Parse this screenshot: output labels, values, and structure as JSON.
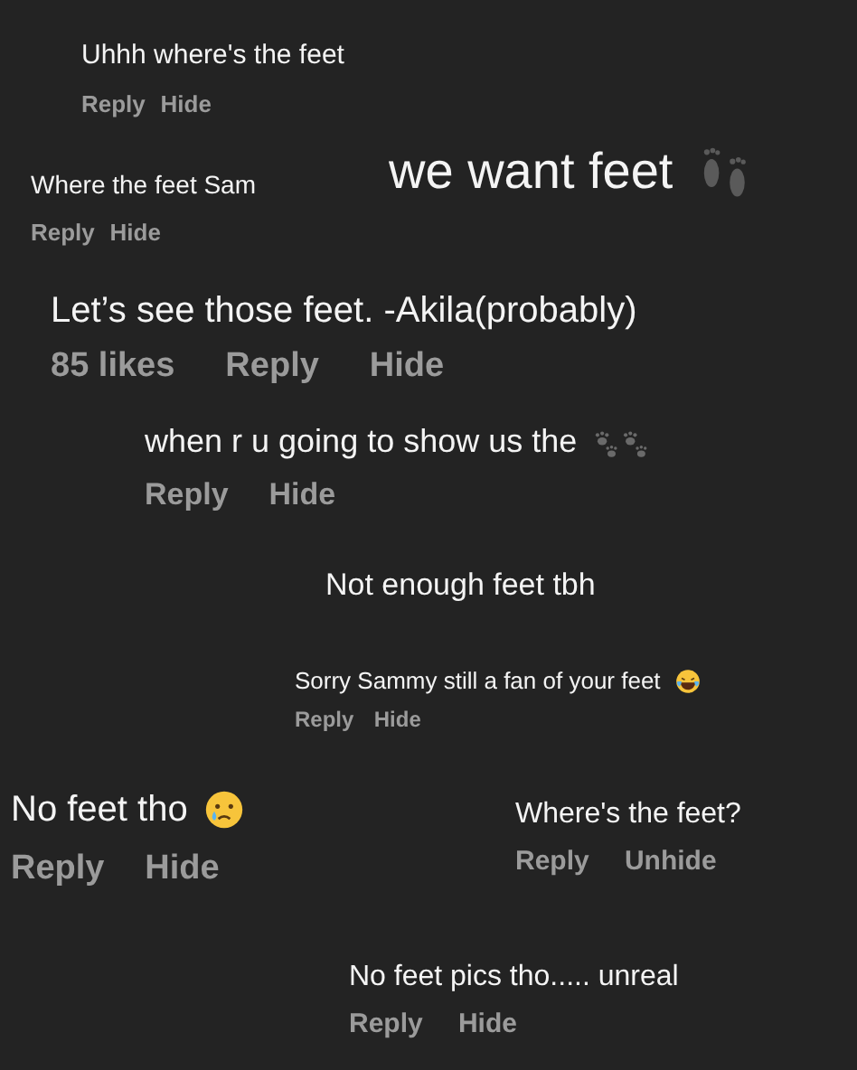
{
  "comments": [
    {
      "kind": "plain",
      "text": "Uhhh where's the feet",
      "actions": [
        "Reply",
        "Hide"
      ]
    },
    {
      "kind": "plain",
      "text": "Where the feet Sam",
      "actions": [
        "Reply",
        "Hide"
      ]
    },
    {
      "kind": "footprints",
      "text": "we want feet"
    },
    {
      "kind": "plain",
      "text": "Let’s see those feet. -Akila(probably)",
      "actions": [
        "85 likes",
        "Reply",
        "Hide"
      ]
    },
    {
      "kind": "paws",
      "text": "when r u going to show us the",
      "actions": [
        "Reply",
        "Hide"
      ]
    },
    {
      "kind": "plain",
      "text": "Not enough feet tbh"
    },
    {
      "kind": "laughing",
      "text": "Sorry Sammy still a fan of your feet",
      "actions": [
        "Reply",
        "Hide"
      ]
    },
    {
      "kind": "crying",
      "text": "No feet tho",
      "actions": [
        "Reply",
        "Hide"
      ]
    },
    {
      "kind": "plain",
      "text": "Where's the feet?",
      "actions": [
        "Reply",
        "Unhide"
      ]
    },
    {
      "kind": "plain",
      "text": "No feet pics tho..... unreal",
      "actions": [
        "Reply",
        "Hide"
      ]
    }
  ]
}
